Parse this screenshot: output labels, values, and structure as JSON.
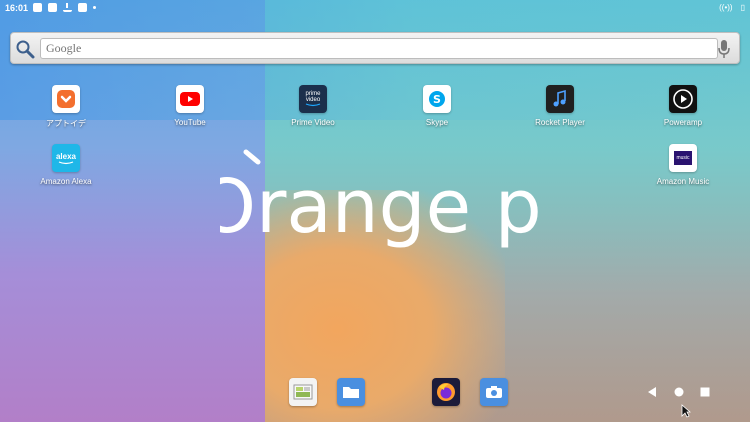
{
  "status_bar": {
    "time": "16:01",
    "icons": [
      "shield-app-icon",
      "box-x-icon",
      "download-icon",
      "file-icon",
      "dot-icon"
    ],
    "right_icons": [
      "wifi-signal-icon",
      "battery-icon"
    ]
  },
  "search": {
    "placeholder": "Google"
  },
  "apps": [
    {
      "label": "アプトイデ",
      "icon": "aptoide-icon"
    },
    {
      "label": "YouTube",
      "icon": "youtube-icon"
    },
    {
      "label": "Prime Video",
      "icon": "prime-video-icon",
      "icon_text": "prime\nvideo"
    },
    {
      "label": "Skype",
      "icon": "skype-icon"
    },
    {
      "label": "Rocket Player",
      "icon": "rocket-player-icon"
    },
    {
      "label": "Poweramp",
      "icon": "poweramp-icon"
    },
    {
      "label": "Amazon Alexa",
      "icon": "alexa-icon",
      "icon_text": "alexa"
    },
    {
      "label": "Amazon Music",
      "icon": "amazon-music-icon",
      "icon_text": "music"
    }
  ],
  "wallpaper": {
    "logo_text": "Orange pi"
  },
  "dock": [
    {
      "icon": "gallery-icon"
    },
    {
      "icon": "files-icon"
    },
    {
      "icon": "firefox-icon"
    },
    {
      "icon": "camera-icon"
    }
  ],
  "nav": [
    "back-icon",
    "home-icon",
    "recents-icon"
  ],
  "colors": {
    "aptoide": "#f36f2e",
    "youtube": "#ff0000",
    "prime": "#1b2f4c",
    "skype": "#00a6ed",
    "alexa": "#1fb7e8",
    "music": "#2a1370"
  }
}
